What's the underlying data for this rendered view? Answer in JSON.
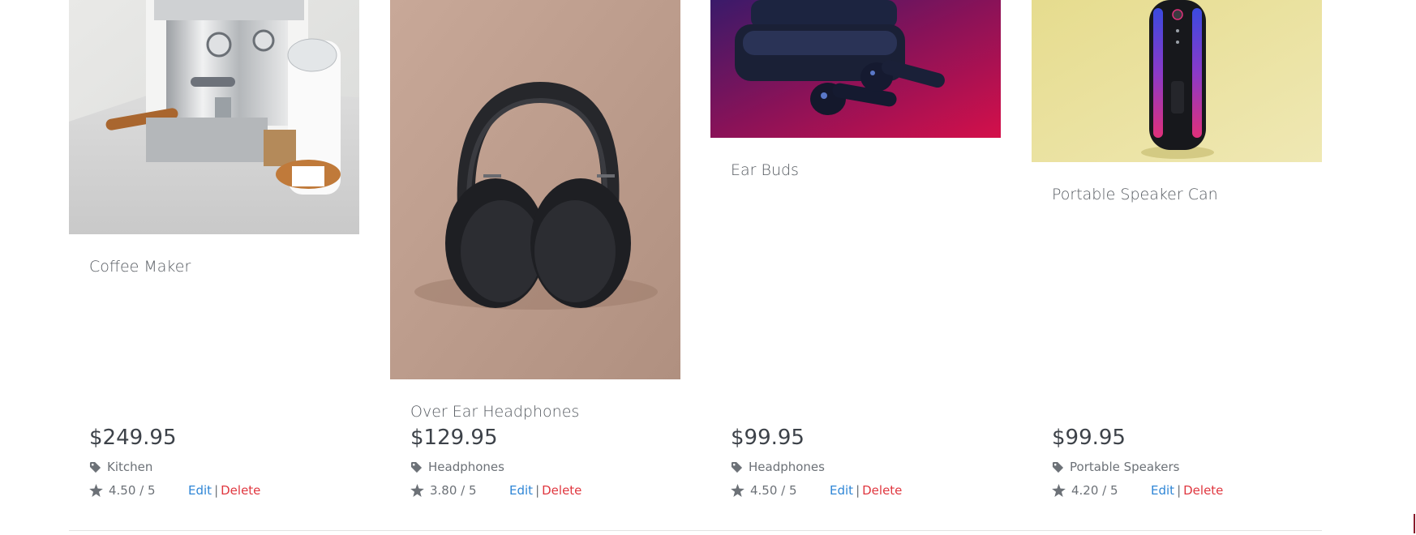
{
  "products": [
    {
      "name": "Coffee Maker",
      "price": "$249.95",
      "category": "Kitchen",
      "rating": "4.50 / 5",
      "edit_label": "Edit",
      "separator": "|",
      "delete_label": "Delete"
    },
    {
      "name": "Over Ear Headphones",
      "price": "$129.95",
      "category": "Headphones",
      "rating": "3.80 / 5",
      "edit_label": "Edit",
      "separator": "|",
      "delete_label": "Delete"
    },
    {
      "name": "Ear Buds",
      "price": "$99.95",
      "category": "Headphones",
      "rating": "4.50 / 5",
      "edit_label": "Edit",
      "separator": "|",
      "delete_label": "Delete"
    },
    {
      "name": "Portable Speaker Can",
      "price": "$99.95",
      "category": "Portable Speakers",
      "rating": "4.20 / 5",
      "edit_label": "Edit",
      "separator": "|",
      "delete_label": "Delete"
    }
  ],
  "icons": {
    "category": "tag-icon",
    "rating": "star-icon"
  },
  "colors": {
    "edit_link": "#2f86d6",
    "delete_link": "#e0373f",
    "text_muted": "#6c7177",
    "price_text": "#3d4249"
  }
}
